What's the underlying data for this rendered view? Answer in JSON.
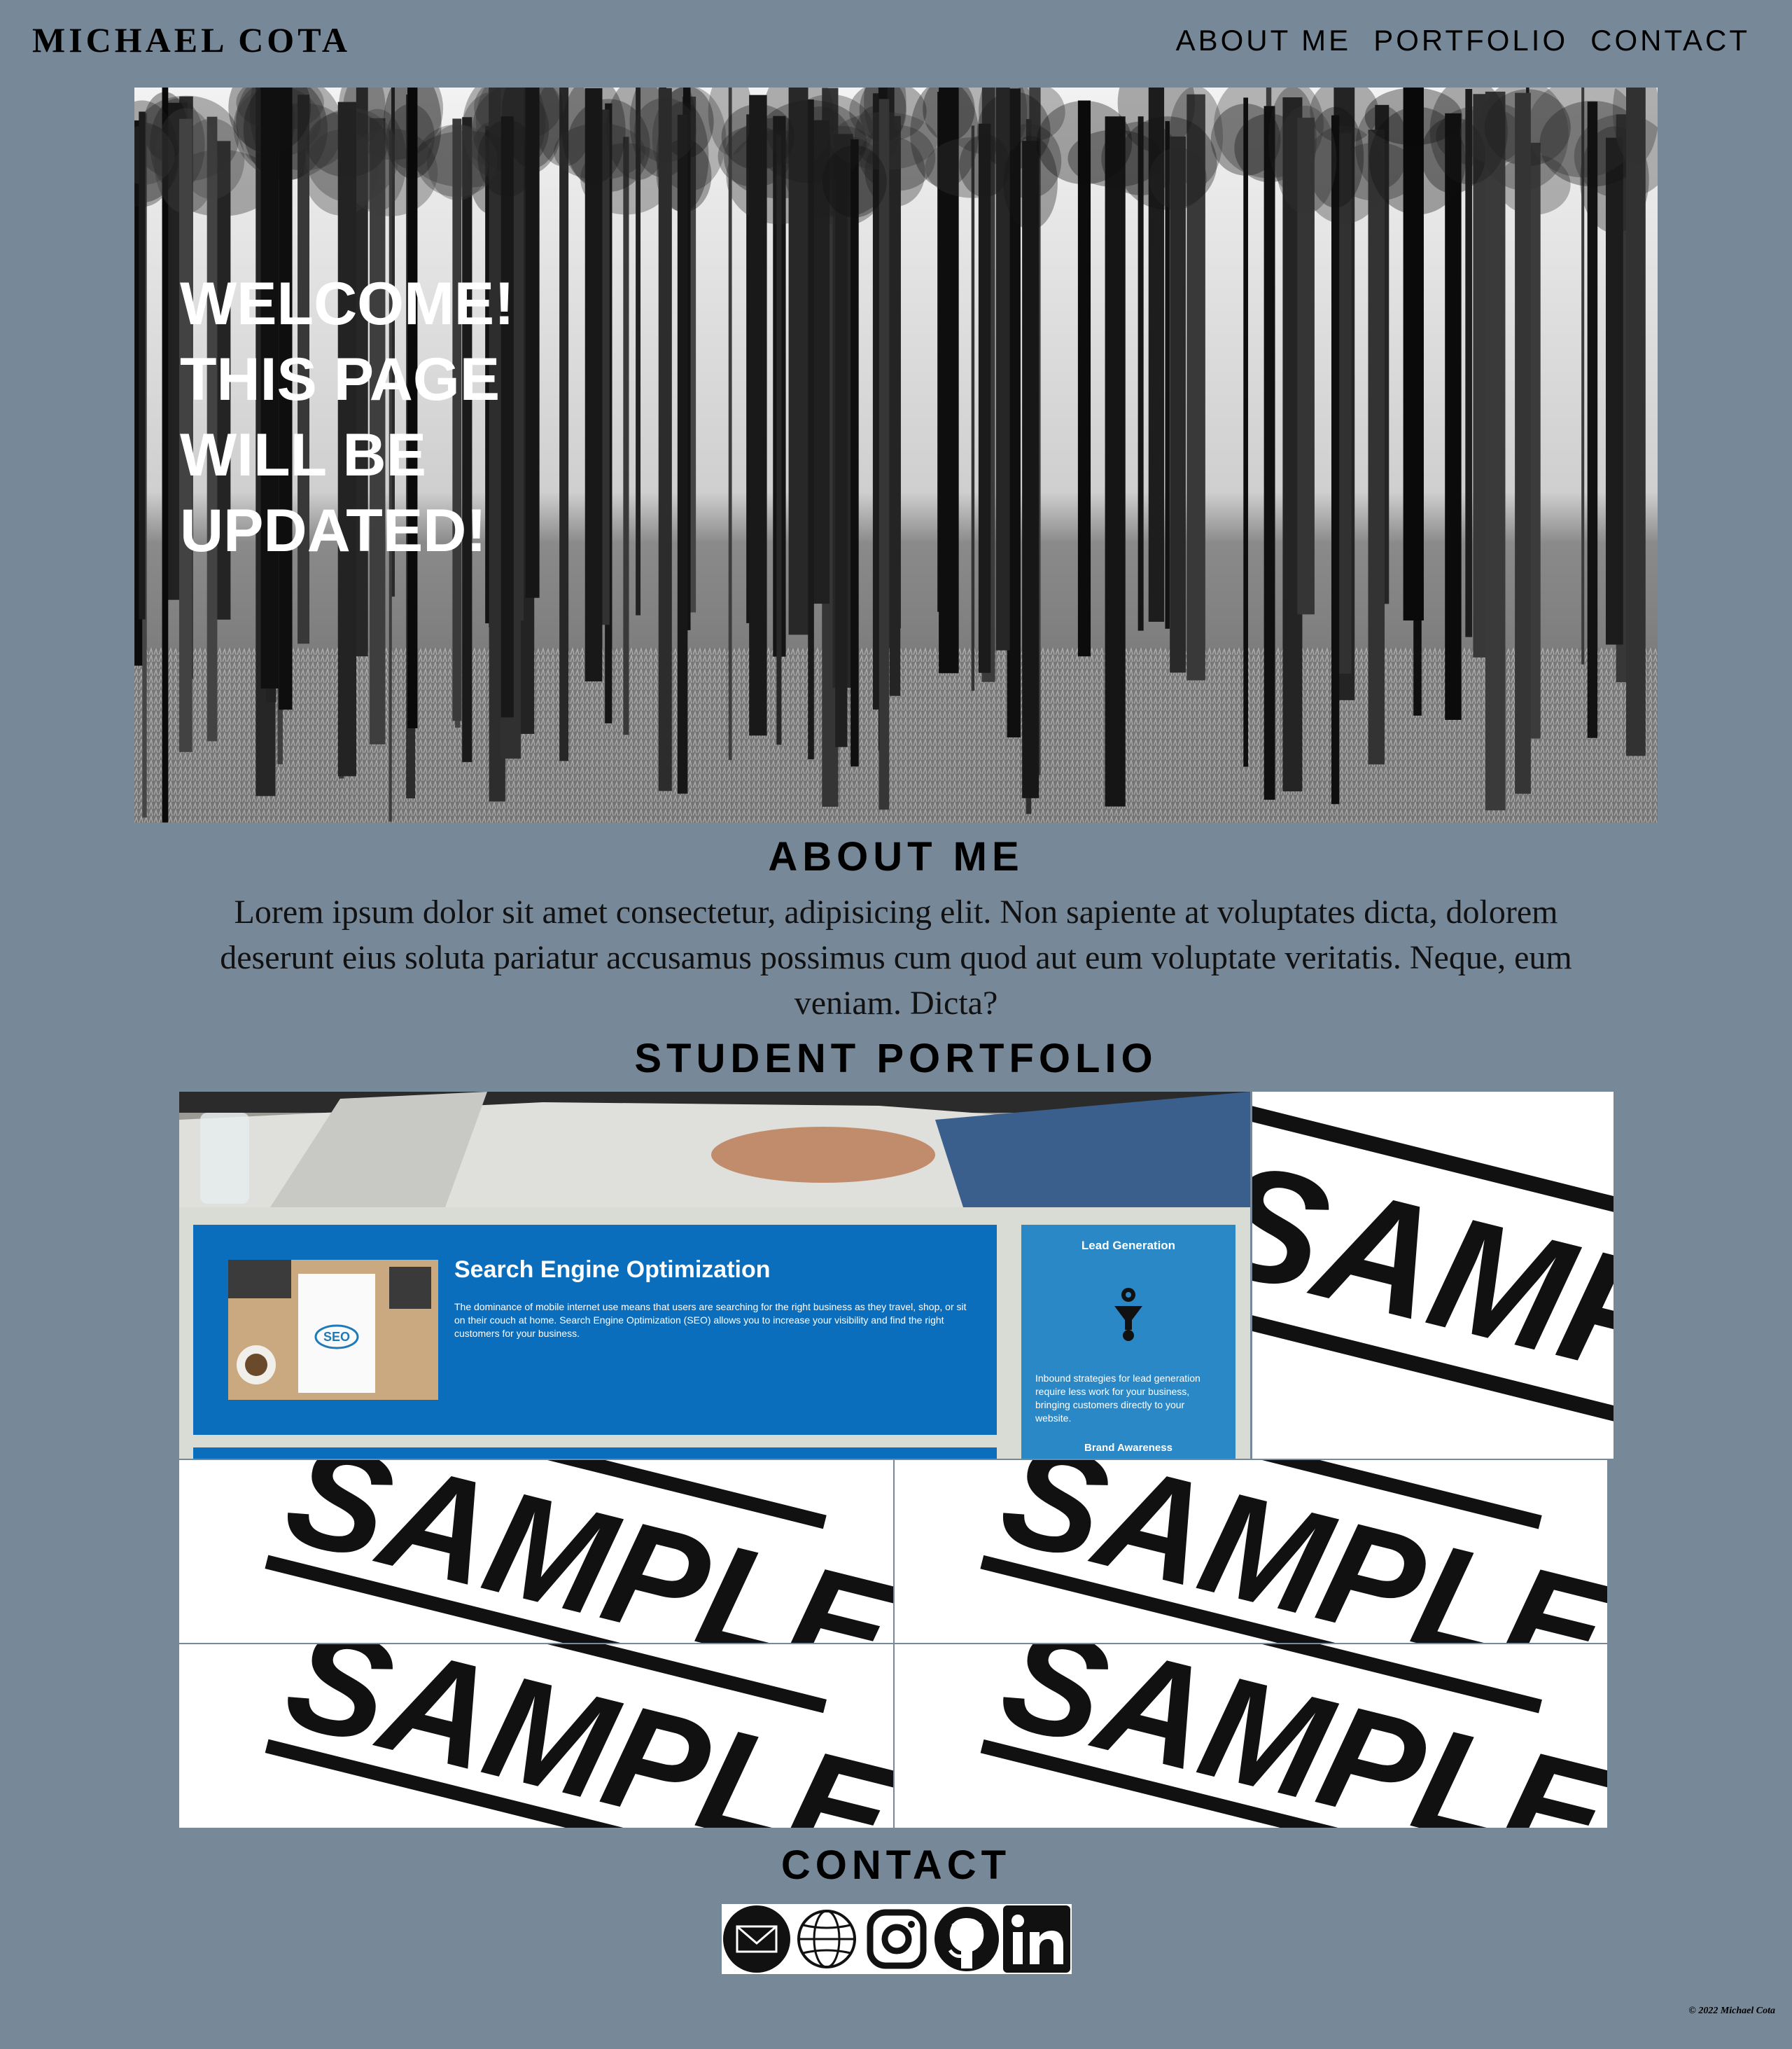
{
  "header": {
    "brand": "MICHAEL COTA",
    "nav": [
      "ABOUT ME",
      "PORTFOLIO",
      "CONTACT"
    ]
  },
  "hero": {
    "heading": "WELCOME! THIS PAGE WILL BE UPDATED!"
  },
  "about": {
    "title": "ABOUT ME",
    "text": "Lorem ipsum dolor sit amet consectetur, adipisicing elit. Non sapiente at voluptates dicta, dolorem deserunt eius soluta pariatur accusamus possimus cum quod aut eum voluptate veritatis. Neque, eum veniam. Dicta?"
  },
  "portfolio": {
    "title": "STUDENT PORTFOLIO",
    "featured": {
      "seo_title": "Search Engine Optimization",
      "seo_desc": "The dominance of mobile internet use means that users are searching for the right business as they travel, shop, or sit on their couch at home. Search Engine Optimization (SEO) allows you to increase your visibility and find the right customers for your business.",
      "lead_title": "Lead Generation",
      "lead_desc": "Inbound strategies for lead generation require less work for your business, bringing customers directly to your website.",
      "next_title": "Brand Awareness"
    },
    "sample_label": "SAMPLE"
  },
  "contact": {
    "title": "CONTACT",
    "icons": [
      "email-icon",
      "globe-icon",
      "instagram-icon",
      "github-icon",
      "linkedin-icon"
    ]
  },
  "footer": {
    "copyright": "© 2022 Michael Cota"
  }
}
